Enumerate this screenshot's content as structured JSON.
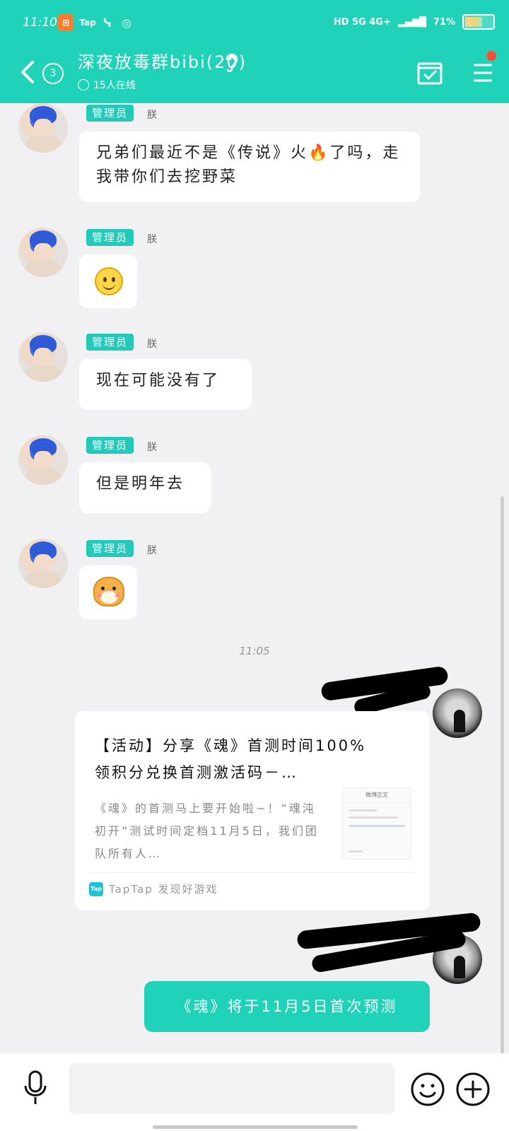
{
  "status_bar": {
    "time": "11:10",
    "apps": [
      "Tap"
    ],
    "network": "HD 5G 4G+",
    "battery_label": "71%",
    "battery_level": 0.71
  },
  "header": {
    "unread_count": "3",
    "group_title": "深夜放毒群bibi(20)",
    "online_text": "15人在线"
  },
  "messages": [
    {
      "badge": "管理员",
      "sender": "朕",
      "text": "兄弟们最近不是《传说》火🔥了吗，走我带你们去挖野菜"
    },
    {
      "badge": "管理员",
      "sender": "朕",
      "sticker": "smile-emoji"
    },
    {
      "badge": "管理员",
      "sender": "朕",
      "text": "现在可能没有了"
    },
    {
      "badge": "管理员",
      "sender": "朕",
      "text": "但是明年去"
    },
    {
      "badge": "管理员",
      "sender": "朕",
      "sticker": "dog-emoji"
    }
  ],
  "timestamp": "11:05",
  "share_card": {
    "title": "【活动】分享《魂》首测时间100%领积分兑换首测激活码－…",
    "description": "《魂》的首测马上要开始啦~！“魂沌初开”测试时间定档11月5日，我们团队所有人…",
    "thumb_header": "微博正文",
    "source": "TapTap 发现好游戏"
  },
  "my_message": "《魂》将于11月5日首次预测",
  "input": {
    "placeholder": ""
  }
}
